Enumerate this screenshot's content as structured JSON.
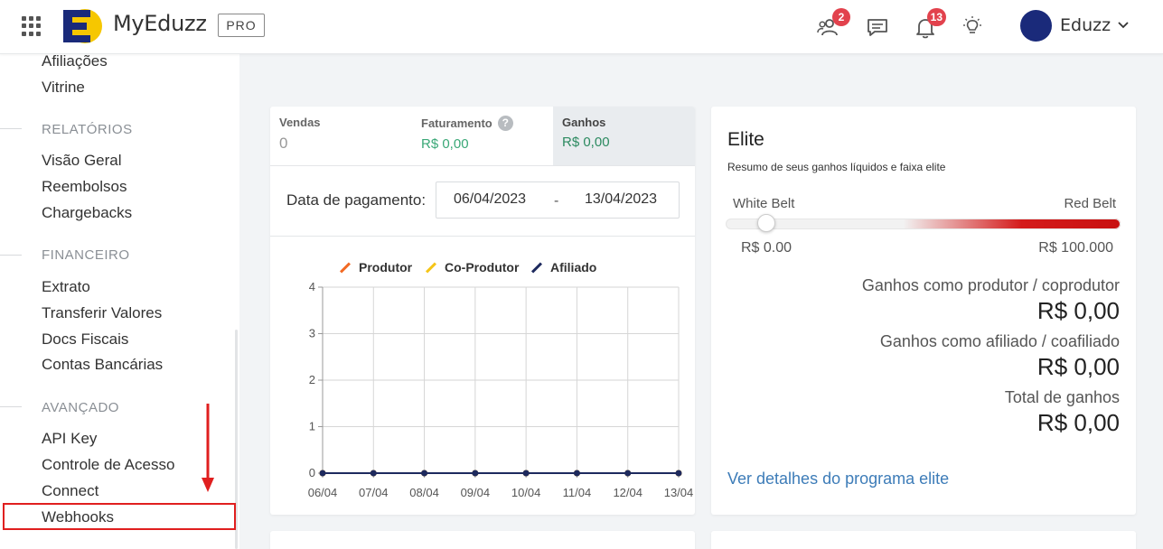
{
  "header": {
    "brand": "MyEduzz",
    "plan_badge": "PRO",
    "affiliates_badge": "2",
    "notifications_badge": "13",
    "user_name": "Eduzz"
  },
  "sidebar": {
    "top_items": [
      "Afiliações",
      "Vitrine"
    ],
    "sections": [
      {
        "title": "RELATÓRIOS",
        "items": [
          "Visão Geral",
          "Reembolsos",
          "Chargebacks"
        ]
      },
      {
        "title": "FINANCEIRO",
        "items": [
          "Extrato",
          "Transferir Valores",
          "Docs Fiscais",
          "Contas Bancárias"
        ]
      },
      {
        "title": "AVANÇADO",
        "items": [
          "API Key",
          "Controle de Acesso",
          "Connect",
          "Webhooks"
        ]
      }
    ]
  },
  "dashboard": {
    "stats": [
      {
        "label": "Vendas",
        "value": "0"
      },
      {
        "label": "Faturamento",
        "value": "R$ 0,00"
      },
      {
        "label": "Ganhos",
        "value": "R$ 0,00"
      }
    ],
    "date_label": "Data de pagamento:",
    "date_from": "06/04/2023",
    "date_separator": "-",
    "date_to": "13/04/2023"
  },
  "chart_data": {
    "type": "line",
    "x": [
      "06/04",
      "07/04",
      "08/04",
      "09/04",
      "10/04",
      "11/04",
      "12/04",
      "13/04"
    ],
    "series": [
      {
        "name": "Produtor",
        "color": "#f26a24",
        "values": [
          0,
          0,
          0,
          0,
          0,
          0,
          0,
          0
        ]
      },
      {
        "name": "Co-Produtor",
        "color": "#f5c518",
        "values": [
          0,
          0,
          0,
          0,
          0,
          0,
          0,
          0
        ]
      },
      {
        "name": "Afiliado",
        "color": "#1e2a5e",
        "values": [
          0,
          0,
          0,
          0,
          0,
          0,
          0,
          0
        ]
      }
    ],
    "yticks": [
      "0",
      "1",
      "2",
      "3",
      "4"
    ],
    "ylim": [
      0,
      4
    ],
    "grid": true,
    "legend_position": "top"
  },
  "elite": {
    "title": "Elite",
    "subtitle": "Resumo de seus ganhos líquidos e faixa elite",
    "belt_left": "White Belt",
    "belt_right": "Red Belt",
    "range_min": "R$ 0.00",
    "range_max": "R$ 100.000",
    "producer_label": "Ganhos como produtor / coprodutor",
    "producer_value": "R$ 0,00",
    "affiliate_label": "Ganhos como afiliado / coafiliado",
    "affiliate_value": "R$ 0,00",
    "total_label": "Total de ganhos",
    "total_value": "R$ 0,00",
    "link": "Ver detalhes do programa elite"
  },
  "colors": {
    "accent_red": "#e01f1f",
    "badge_red": "#e2424d",
    "positive_green": "#3aa877",
    "link_blue": "#3d7cb8",
    "brand_blue": "#1a2a7a",
    "brand_yellow": "#f6c700"
  }
}
